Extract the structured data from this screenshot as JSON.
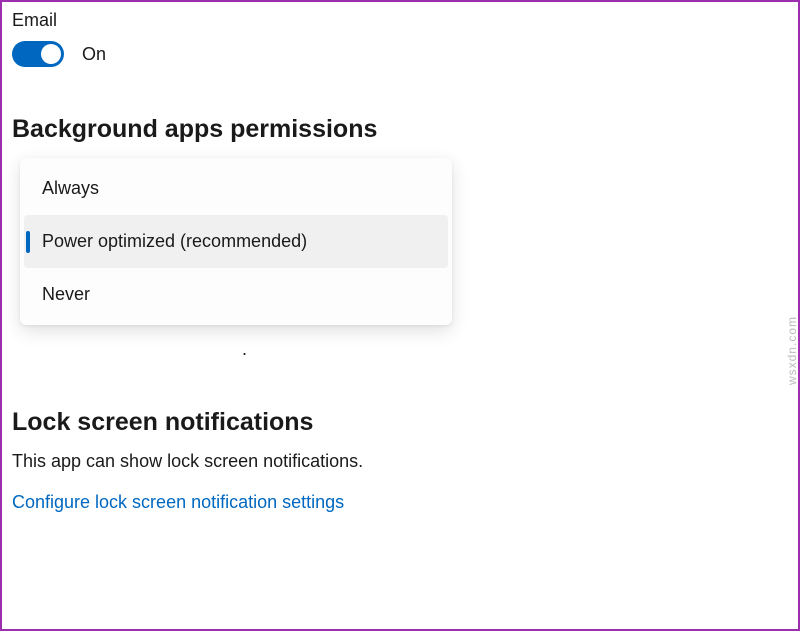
{
  "email": {
    "label": "Email",
    "toggle_state": "On"
  },
  "background_permissions": {
    "heading": "Background apps permissions",
    "options": {
      "always": "Always",
      "power_optimized": "Power optimized (recommended)",
      "never": "Never"
    },
    "selected": "power_optimized"
  },
  "lock_screen": {
    "heading": "Lock screen notifications",
    "description": "This app can show lock screen notifications.",
    "link": "Configure lock screen notification settings"
  },
  "watermark": "wsxdn.com"
}
